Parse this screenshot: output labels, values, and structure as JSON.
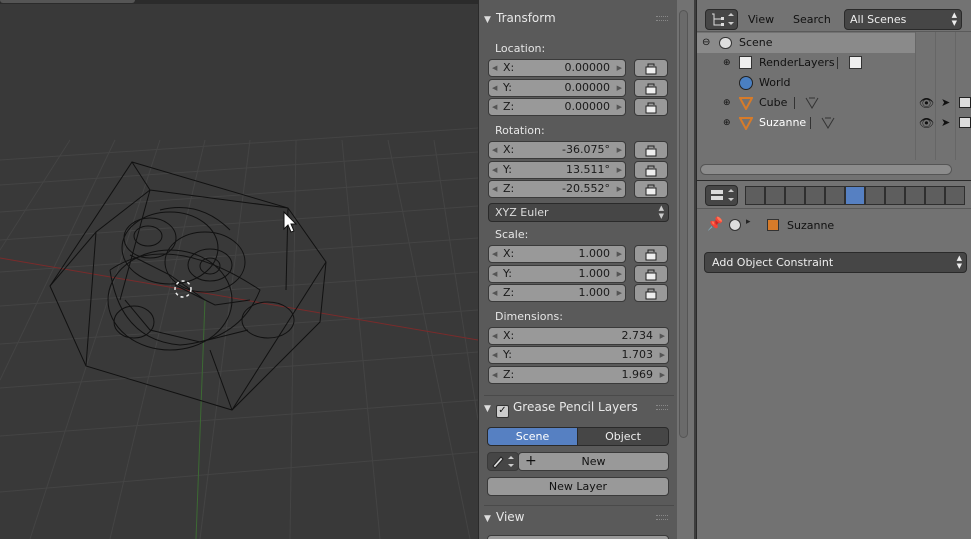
{
  "transform": {
    "title": "Transform",
    "location_label": "Location:",
    "location": [
      {
        "axis": "X:",
        "value": "0.00000"
      },
      {
        "axis": "Y:",
        "value": "0.00000"
      },
      {
        "axis": "Z:",
        "value": "0.00000"
      }
    ],
    "rotation_label": "Rotation:",
    "rotation": [
      {
        "axis": "X:",
        "value": "-36.075°"
      },
      {
        "axis": "Y:",
        "value": "13.511°"
      },
      {
        "axis": "Z:",
        "value": "-20.552°"
      }
    ],
    "rotation_mode": "XYZ Euler",
    "scale_label": "Scale:",
    "scale": [
      {
        "axis": "X:",
        "value": "1.000"
      },
      {
        "axis": "Y:",
        "value": "1.000"
      },
      {
        "axis": "Z:",
        "value": "1.000"
      }
    ],
    "dimensions_label": "Dimensions:",
    "dimensions": [
      {
        "axis": "X:",
        "value": "2.734"
      },
      {
        "axis": "Y:",
        "value": "1.703"
      },
      {
        "axis": "Z:",
        "value": "1.969"
      }
    ]
  },
  "grease_pencil": {
    "title": "Grease Pencil Layers",
    "scene_tab": "Scene",
    "object_tab": "Object",
    "new_label": "New",
    "new_layer_label": "New Layer"
  },
  "view_panel": {
    "title": "View"
  },
  "outliner": {
    "menu_view": "View",
    "menu_search": "Search",
    "display_mode": "All Scenes",
    "rows": [
      {
        "name": "Scene",
        "icon": "scene-icon"
      },
      {
        "name": "RenderLayers",
        "icon": "render-layers-icon"
      },
      {
        "name": "World",
        "icon": "world-icon"
      },
      {
        "name": "Cube",
        "icon": "object-icon"
      },
      {
        "name": "Suzanne",
        "icon": "object-icon"
      }
    ]
  },
  "properties": {
    "breadcrumb_object": "Suzanne",
    "add_constraint": "Add Object Constraint",
    "context_tabs": [
      "render-icon",
      "render-layers-icon",
      "scene-icon",
      "world-icon",
      "object-icon",
      "constraints-icon",
      "modifiers-icon",
      "data-icon",
      "material-icon",
      "texture-icon",
      "particles-icon"
    ]
  },
  "colors": {
    "accent": "#5680c2",
    "viewport_bg": "#393939",
    "panel_bg": "#727272"
  }
}
